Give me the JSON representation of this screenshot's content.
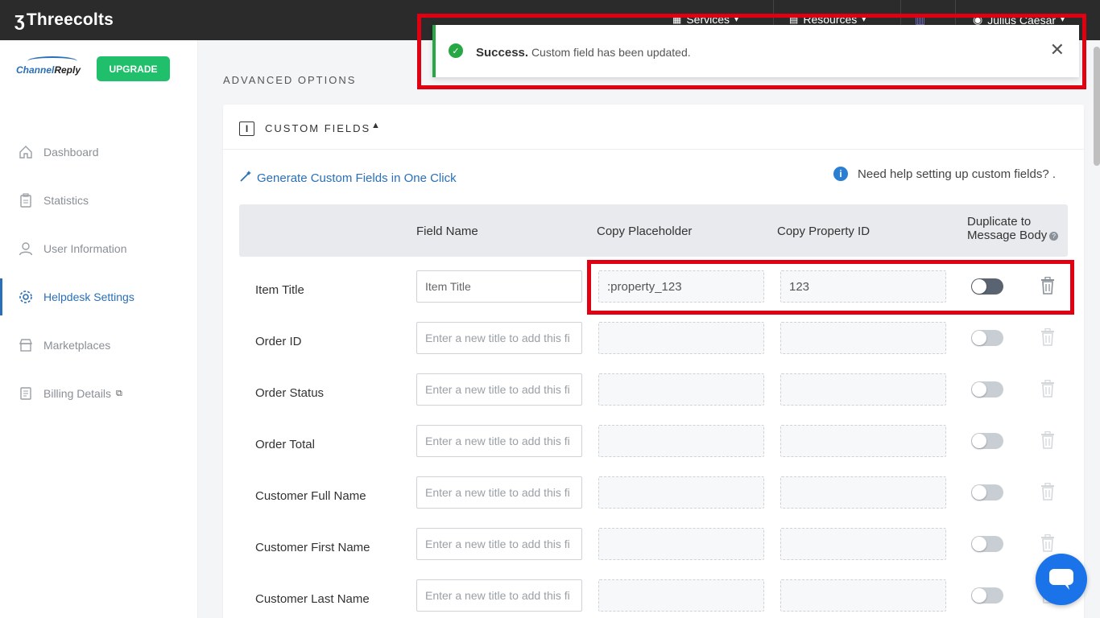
{
  "topbar": {
    "brand": "Threecolts",
    "nav": [
      {
        "label": "Services"
      },
      {
        "label": "Resources"
      }
    ],
    "user_name": "Julius Caesar"
  },
  "sidebar": {
    "logo_text_1": "Channel",
    "logo_text_2": "Reply",
    "upgrade_label": "UPGRADE",
    "items": [
      {
        "label": "Dashboard",
        "icon": "home-icon"
      },
      {
        "label": "Statistics",
        "icon": "clipboard-icon"
      },
      {
        "label": "User Information",
        "icon": "user-icon"
      },
      {
        "label": "Helpdesk Settings",
        "icon": "gear-icon"
      },
      {
        "label": "Marketplaces",
        "icon": "store-icon"
      },
      {
        "label": "Billing Details",
        "icon": "receipt-icon"
      }
    ]
  },
  "main": {
    "section_title": "ADVANCED OPTIONS",
    "card_title": "CUSTOM FIELDS",
    "generate_link": "Generate Custom Fields in One Click",
    "help_text": "Need help setting up custom fields? .",
    "columns": {
      "field_name": "Field Name",
      "copy_placeholder": "Copy Placeholder",
      "copy_property_id": "Copy Property ID",
      "duplicate_line1": "Duplicate to",
      "duplicate_line2": "Message Body"
    },
    "input_placeholder": "Enter a new title to add this fi",
    "rows": [
      {
        "label": "Item Title",
        "value": "Item Title",
        "placeholder_code": ":property_123",
        "property_id": "123"
      },
      {
        "label": "Order ID",
        "value": "",
        "placeholder_code": "",
        "property_id": ""
      },
      {
        "label": "Order Status",
        "value": "",
        "placeholder_code": "",
        "property_id": ""
      },
      {
        "label": "Order Total",
        "value": "",
        "placeholder_code": "",
        "property_id": ""
      },
      {
        "label": "Customer Full Name",
        "value": "",
        "placeholder_code": "",
        "property_id": ""
      },
      {
        "label": "Customer First Name",
        "value": "",
        "placeholder_code": "",
        "property_id": ""
      },
      {
        "label": "Customer Last Name",
        "value": "",
        "placeholder_code": "",
        "property_id": ""
      }
    ]
  },
  "toast": {
    "bold": "Success.",
    "message": "Custom field has been updated."
  },
  "colors": {
    "accent": "#2a6fb7",
    "success": "#28a745",
    "upgrade": "#1fbf6b",
    "highlight": "#e00012",
    "chat": "#1a73e8"
  }
}
